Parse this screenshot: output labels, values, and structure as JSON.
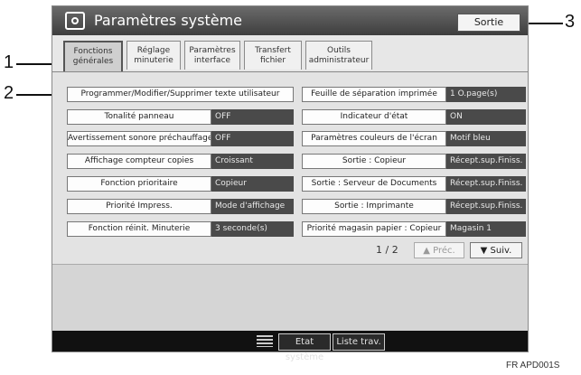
{
  "callouts": {
    "c1": "1",
    "c2": "2",
    "c3": "3"
  },
  "window": {
    "title": "Paramètres système",
    "exit_label": "Sortie"
  },
  "tabs": [
    {
      "line1": "Fonctions",
      "line2": "générales"
    },
    {
      "line1": "Réglage",
      "line2": "minuterie"
    },
    {
      "line1": "Paramètres",
      "line2": "interface"
    },
    {
      "line1": "Transfert",
      "line2": "fichier"
    },
    {
      "line1": "Outils",
      "line2": "administrateur"
    }
  ],
  "settings_left": [
    {
      "label": "Programmer/Modifier/Supprimer texte utilisateur"
    },
    {
      "label": "Tonalité panneau",
      "value": "OFF"
    },
    {
      "label": "Avertissement sonore préchauffage",
      "value": "OFF"
    },
    {
      "label": "Affichage compteur copies",
      "value": "Croissant"
    },
    {
      "label": "Fonction prioritaire",
      "value": "Copieur"
    },
    {
      "label": "Priorité Impress.",
      "value": "Mode d'affichage"
    },
    {
      "label": "Fonction réinit. Minuterie",
      "value": "3 seconde(s)"
    }
  ],
  "settings_right": [
    {
      "label": "Feuille de séparation imprimée",
      "value": "1 O.page(s)"
    },
    {
      "label": "Indicateur d'état",
      "value": "ON"
    },
    {
      "label": "Paramètres couleurs de l'écran",
      "value": "Motif bleu"
    },
    {
      "label": "Sortie : Copieur",
      "value": "Récept.sup.Finiss."
    },
    {
      "label": "Sortie : Serveur de Documents",
      "value": "Récept.sup.Finiss."
    },
    {
      "label": "Sortie : Imprimante",
      "value": "Récept.sup.Finiss."
    },
    {
      "label": "Priorité magasin papier : Copieur",
      "value": "Magasin 1"
    }
  ],
  "pagination": {
    "page": "1 / 2",
    "prev": "▲ Préc.",
    "next": "▼ Suiv."
  },
  "statusbar": {
    "btn1": "Etat système",
    "btn2": "Liste trav."
  },
  "figure_code": "FR APD001S"
}
